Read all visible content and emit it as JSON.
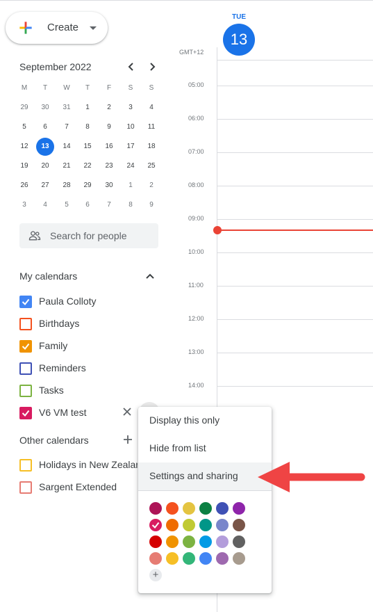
{
  "create": {
    "label": "Create"
  },
  "mini_calendar": {
    "month_label": "September 2022",
    "weekday_headers": [
      "M",
      "T",
      "W",
      "T",
      "F",
      "S",
      "S"
    ],
    "weeks": [
      [
        "29",
        "30",
        "31",
        "1",
        "2",
        "3",
        "4"
      ],
      [
        "5",
        "6",
        "7",
        "8",
        "9",
        "10",
        "11"
      ],
      [
        "12",
        "13",
        "14",
        "15",
        "16",
        "17",
        "18"
      ],
      [
        "19",
        "20",
        "21",
        "22",
        "23",
        "24",
        "25"
      ],
      [
        "26",
        "27",
        "28",
        "29",
        "30",
        "1",
        "2"
      ],
      [
        "3",
        "4",
        "5",
        "6",
        "7",
        "8",
        "9"
      ]
    ],
    "today": "13"
  },
  "search": {
    "placeholder": "Search for people"
  },
  "my_calendars": {
    "title": "My calendars",
    "items": [
      {
        "label": "Paula Colloty",
        "color": "#4285f4",
        "checked": true
      },
      {
        "label": "Birthdays",
        "color": "#f4511e",
        "checked": false
      },
      {
        "label": "Family",
        "color": "#f09300",
        "checked": true
      },
      {
        "label": "Reminders",
        "color": "#3f51b5",
        "checked": false
      },
      {
        "label": "Tasks",
        "color": "#7cb342",
        "checked": false
      },
      {
        "label": "V6 VM test",
        "color": "#d81b60",
        "checked": true
      }
    ]
  },
  "other_calendars": {
    "title": "Other calendars",
    "items": [
      {
        "label": "Holidays in New Zealand",
        "color": "#f6bf26",
        "checked": false
      },
      {
        "label": "Sargent Extended",
        "color": "#e67c73",
        "checked": false
      }
    ]
  },
  "day_view": {
    "weekday": "TUE",
    "date": "13",
    "timezone": "GMT+12",
    "hours": [
      "05:00",
      "06:00",
      "07:00",
      "08:00",
      "09:00",
      "10:00",
      "11:00",
      "12:00",
      "13:00",
      "14:00"
    ],
    "accent": "#1a73e8",
    "now_line_color": "#ea4335"
  },
  "context_menu": {
    "items": [
      "Display this only",
      "Hide from list",
      "Settings and sharing"
    ],
    "colors": [
      [
        "#ad1457",
        "#f4511e",
        "#e4c441",
        "#0b8043",
        "#3f51b5",
        "#8e24aa"
      ],
      [
        "#d81b60",
        "#ef6c00",
        "#c0ca33",
        "#009688",
        "#7986cb",
        "#795548"
      ],
      [
        "#d50000",
        "#f09300",
        "#7cb342",
        "#039be5",
        "#b39ddb",
        "#616161"
      ],
      [
        "#e67c73",
        "#f6bf26",
        "#33b679",
        "#4285f4",
        "#9e69af",
        "#a79b8e"
      ]
    ],
    "selected_color": "#d81b60",
    "add_color_label": "+"
  },
  "annotation": {
    "arrow_color": "#ef4444"
  }
}
